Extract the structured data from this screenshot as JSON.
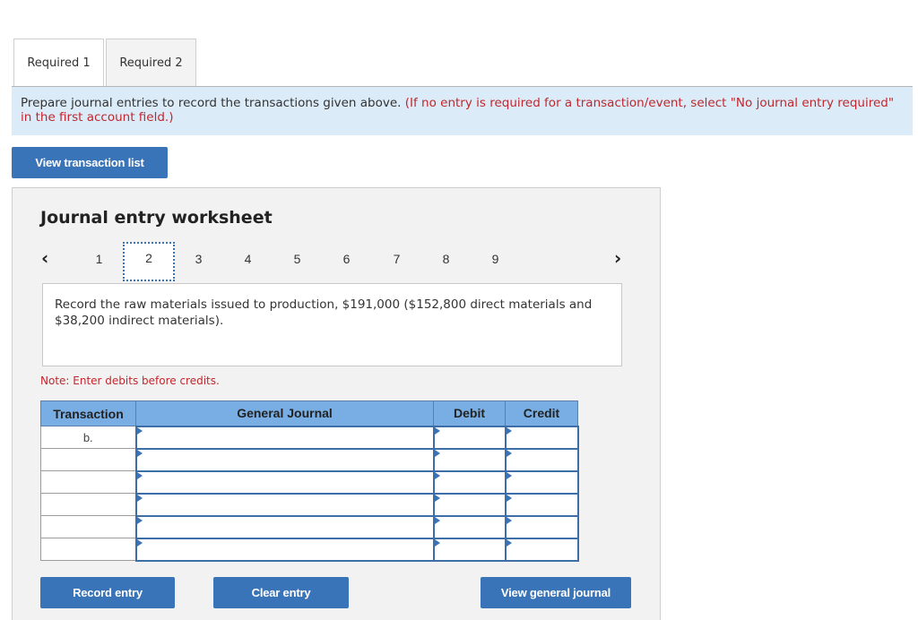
{
  "tabs": [
    {
      "label": "Required 1",
      "active": true
    },
    {
      "label": "Required 2",
      "active": false
    }
  ],
  "instructions": {
    "main": "Prepare journal entries to record the transactions given above.",
    "note": "(If no entry is required for a transaction/event, select \"No journal entry required\" in the first account field.)"
  },
  "view_transaction_list_label": "View transaction list",
  "worksheet": {
    "title": "Journal entry worksheet",
    "pager": {
      "prev_icon": "chevron-left-icon",
      "next_icon": "chevron-right-icon",
      "pages": [
        "1",
        "2",
        "3",
        "4",
        "5",
        "6",
        "7",
        "8",
        "9"
      ],
      "current_page": "2"
    },
    "description": "Record the raw materials issued to production, $191,000 ($152,800 direct materials and $38,200 indirect materials).",
    "note": "Note: Enter debits before credits.",
    "table": {
      "headers": [
        "Transaction",
        "General Journal",
        "Debit",
        "Credit"
      ],
      "rows": [
        {
          "transaction": "b.",
          "account": "",
          "debit": "",
          "credit": ""
        },
        {
          "transaction": "",
          "account": "",
          "debit": "",
          "credit": ""
        },
        {
          "transaction": "",
          "account": "",
          "debit": "",
          "credit": ""
        },
        {
          "transaction": "",
          "account": "",
          "debit": "",
          "credit": ""
        },
        {
          "transaction": "",
          "account": "",
          "debit": "",
          "credit": ""
        },
        {
          "transaction": "",
          "account": "",
          "debit": "",
          "credit": ""
        }
      ]
    },
    "buttons": {
      "record": "Record entry",
      "clear": "Clear entry",
      "view_general_journal": "View general journal"
    }
  },
  "colors": {
    "primary_button": "#3a74b8",
    "header_blue": "#78aee3",
    "instruction_bg": "#dbebf8",
    "note_red": "#c1272d"
  }
}
